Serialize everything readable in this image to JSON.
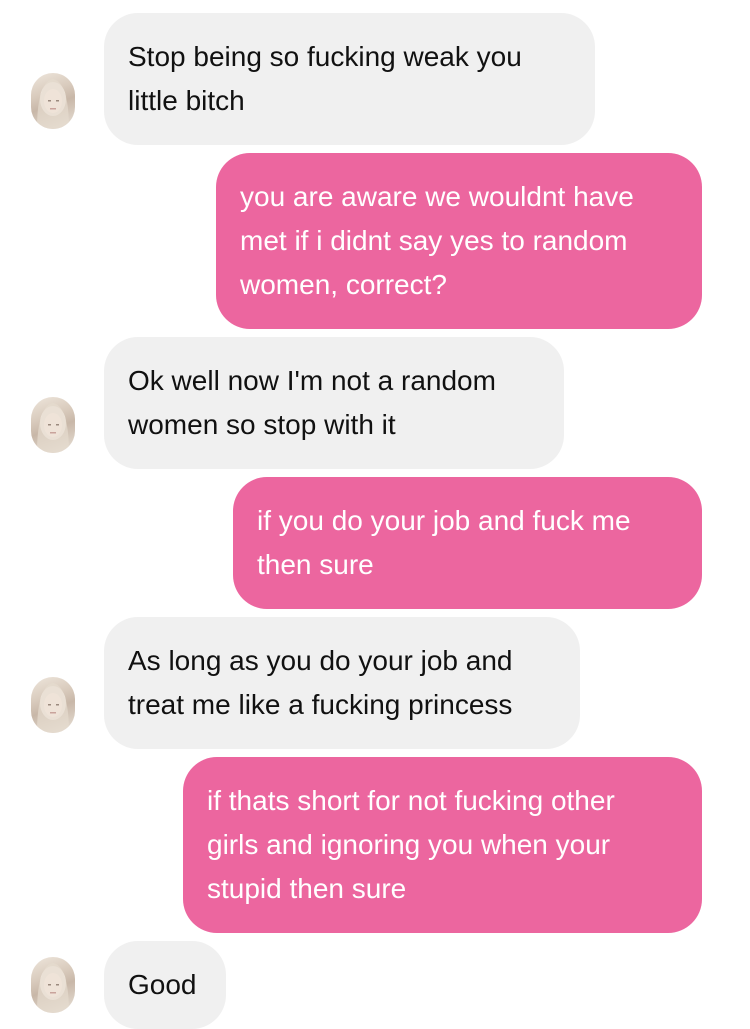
{
  "colors": {
    "incoming_bubble": "#f0f0f0",
    "outgoing_bubble": "#ec669f",
    "incoming_text": "#111111",
    "outgoing_text": "#ffffff"
  },
  "contact": {
    "avatar_icon": "profile-photo-icon"
  },
  "messages": [
    {
      "direction": "incoming",
      "text": "Stop being so fucking weak you\nlittle bitch"
    },
    {
      "direction": "outgoing",
      "text": "you are aware we wouldnt have\nmet if i didnt say yes to random\nwomen, correct?"
    },
    {
      "direction": "incoming",
      "text": "Ok well now I'm not a random\nwomen so stop with it"
    },
    {
      "direction": "outgoing",
      "text": "if you do your job and fuck me\nthen sure"
    },
    {
      "direction": "incoming",
      "text": "As long as you do your job and\ntreat me like a fucking princess"
    },
    {
      "direction": "outgoing",
      "text": "if thats short for not fucking other\ngirls and ignoring you when your\nstupid then sure"
    },
    {
      "direction": "incoming",
      "text": "Good"
    }
  ]
}
